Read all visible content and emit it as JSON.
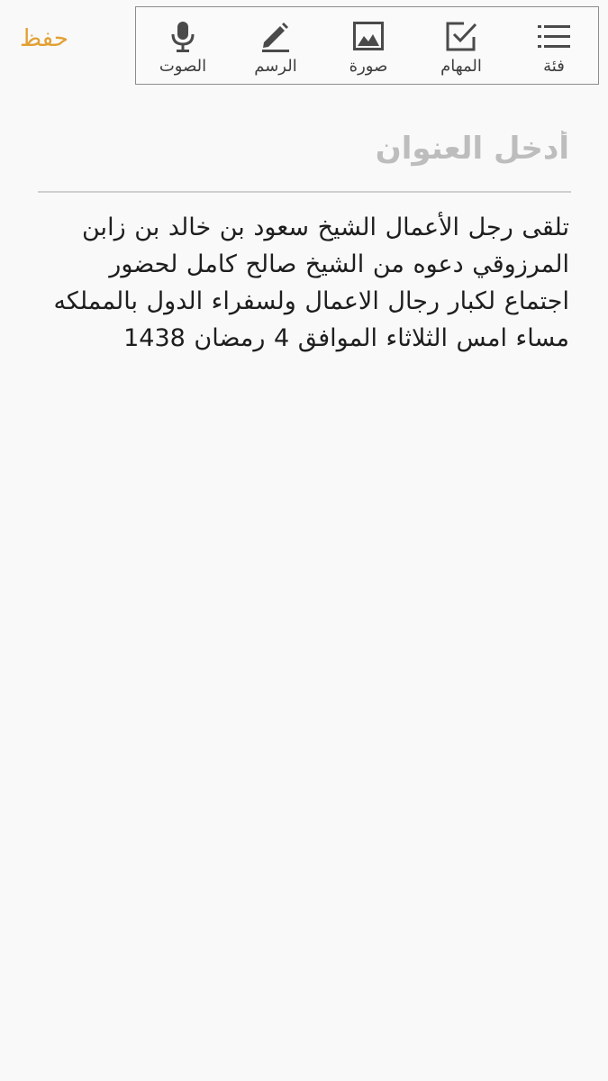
{
  "header": {
    "save_label": "حفظ"
  },
  "toolbar": {
    "items": [
      {
        "label": "فئة",
        "icon": "category-list-icon"
      },
      {
        "label": "المهام",
        "icon": "checkbox-icon"
      },
      {
        "label": "صورة",
        "icon": "image-icon"
      },
      {
        "label": "الرسم",
        "icon": "pen-icon"
      },
      {
        "label": "الصوت",
        "icon": "microphone-icon"
      }
    ]
  },
  "note": {
    "title_placeholder": "أدخل العنوان",
    "body": "تلقى رجل الأعمال الشيخ سعود بن خالد بن زابن المرزوقي  دعوه من الشيخ صالح كامل لحضور اجتماع لكبار رجال الاعمال ولسفراء الدول بالمملكه مساء امس الثلاثاء الموافق 4 رمضان 1438"
  },
  "colors": {
    "accent": "#e3a032",
    "icon": "#4a4a4a",
    "background": "#f9f9f9"
  }
}
